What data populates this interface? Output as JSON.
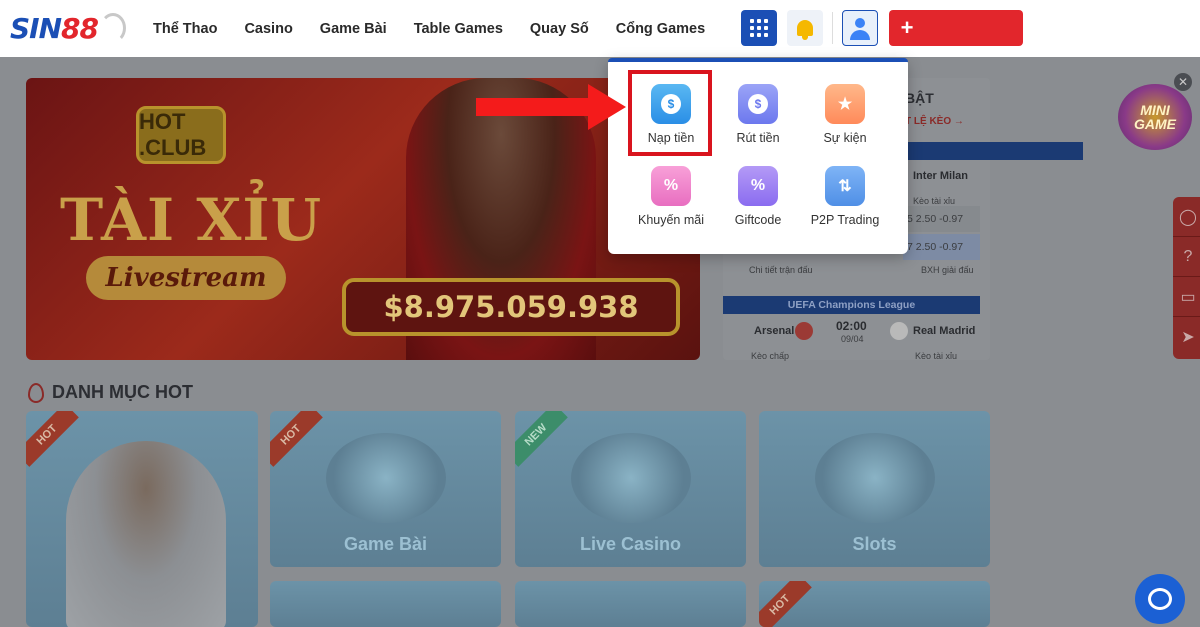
{
  "header": {
    "logo_text": "SIN88",
    "nav": [
      "Thể Thao",
      "Casino",
      "Game Bài",
      "Table Games",
      "Quay Số",
      "Cổng Games"
    ]
  },
  "popup": {
    "items": [
      {
        "label": "Nạp tiền",
        "icon": "deposit-icon"
      },
      {
        "label": "Rút tiền",
        "icon": "withdraw-icon"
      },
      {
        "label": "Sự kiện",
        "icon": "calendar-icon"
      },
      {
        "label": "Khuyến mãi",
        "icon": "promo-icon"
      },
      {
        "label": "Giftcode",
        "icon": "ticket-icon"
      },
      {
        "label": "P2P Trading",
        "icon": "transfer-icon"
      }
    ]
  },
  "banner": {
    "logo": "HOT .CLUB",
    "title": "TÀI XỈU",
    "subtitle": "Livestream",
    "jackpot": "$8.975.059.938"
  },
  "right_panel": {
    "title_fragment": "BẬT",
    "link": "T LỆ KÈO →",
    "match1": {
      "away": "Inter Milan",
      "odds_label": "Kèo tài xỉu",
      "row1": "5  2.50  -0.97",
      "row2": "7  2.50  -0.97"
    },
    "detail_link": "Chi tiết trận đấu",
    "standings_link": "BXH giải đấu",
    "league": "UEFA Champions League",
    "match2": {
      "home": "Arsenal",
      "time": "02:00",
      "date": "09/04",
      "away": "Real Madrid",
      "handicap_label": "Kèo chấp",
      "ou_label": "Kèo tài xỉu"
    }
  },
  "hot_section": {
    "title": "DANH MỤC HOT",
    "tiles": [
      {
        "label": "",
        "ribbon": "HOT"
      },
      {
        "label": "Game Bài",
        "ribbon": "HOT"
      },
      {
        "label": "Live Casino",
        "ribbon": "NEW"
      },
      {
        "label": "Slots",
        "ribbon": ""
      },
      {
        "label": "",
        "ribbon": ""
      },
      {
        "label": "",
        "ribbon": ""
      },
      {
        "label": "",
        "ribbon": "HOT"
      }
    ]
  },
  "minigame": {
    "label": "MINI GAME"
  },
  "colors": {
    "brand_blue": "#1b4fb5",
    "brand_red": "#e2262c",
    "highlight_red": "#d9141e"
  }
}
